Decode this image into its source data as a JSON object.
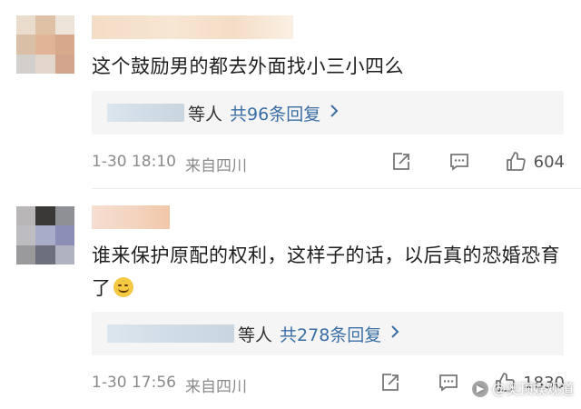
{
  "comments": [
    {
      "text": "这个鼓励男的都去外面找小三小四么",
      "reply_suffix": "等人",
      "reply_count": "共96条回复",
      "time": "1-30 18:10",
      "location": "来自四川",
      "likes": "604",
      "avatar_colors": [
        "#e9dccd",
        "#dfc2a6",
        "#efe4da",
        "#d8bfa5",
        "#e2b497",
        "#d7a889",
        "#d2cfcc",
        "#e3d6cb",
        "#d2a58c"
      ]
    },
    {
      "text": "谁来保护原配的权利，这样子的话，以后真的恐婚恐育了",
      "reply_suffix": "等人",
      "reply_count": "共278条回复",
      "time": "1-30 17:56",
      "location": "来自四川",
      "likes": "1830",
      "avatar_colors": [
        "#b9b6b7",
        "#3b3838",
        "#8f9096",
        "#bdbcc0",
        "#a9acc9",
        "#8b8fb7",
        "#9a9a9c",
        "#6e6f7c",
        "#b0b2c2"
      ]
    }
  ],
  "icons": {
    "share": "share-icon",
    "reply": "comment-icon",
    "like": "thumbs-up-icon",
    "chevron": "chevron-right-icon",
    "emoji": "grinning-face-emoji"
  },
  "watermark": {
    "text": "@奥顶娱观道"
  },
  "colors": {
    "link": "#3a6ea5",
    "meta": "#8a8a8a",
    "reply_bg": "#f5f5f5"
  }
}
